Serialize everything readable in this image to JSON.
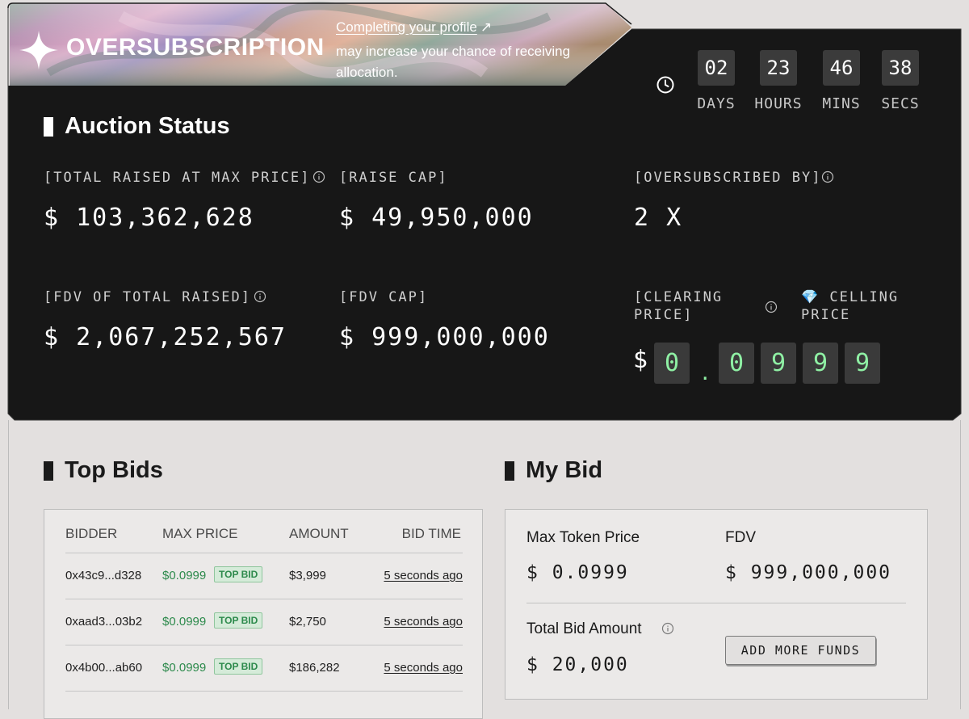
{
  "banner": {
    "title": "OVERSUBSCRIPTION",
    "link_text": "Completing your profile",
    "link_arrow": "↗",
    "subtitle": "may increase your chance of receiving allocation."
  },
  "countdown": [
    {
      "value": "02",
      "label": "DAYS"
    },
    {
      "value": "23",
      "label": "HOURS"
    },
    {
      "value": "46",
      "label": "MINS"
    },
    {
      "value": "38",
      "label": "SECS"
    }
  ],
  "auction": {
    "title": "Auction Status",
    "total_raised_label": "[TOTAL RAISED AT MAX PRICE]",
    "total_raised_value": "$ 103,362,628",
    "raise_cap_label": "[RAISE CAP]",
    "raise_cap_value": "$ 49,950,000",
    "oversubscribed_label": "[OVERSUBSCRIBED BY]",
    "oversubscribed_value": "2 X",
    "fdv_total_label": "[FDV OF TOTAL RAISED]",
    "fdv_total_value": "$ 2,067,252,567",
    "fdv_cap_label": "[FDV CAP]",
    "fdv_cap_value": "$ 999,000,000",
    "clearing_label_line1": "[CLEARING",
    "clearing_label_line2": "PRICE]",
    "ceiling_icon": "💎",
    "ceiling_label_line1": "CELLING",
    "ceiling_label_line2": "PRICE",
    "price_currency": "$",
    "price_digits": [
      "0",
      ".",
      "0",
      "9",
      "9",
      "9"
    ]
  },
  "top_bids": {
    "title": "Top Bids",
    "columns": [
      "BIDDER",
      "MAX PRICE",
      "AMOUNT",
      "BID TIME"
    ],
    "rows": [
      {
        "bidder": "0x43c9...d328",
        "max_price": "$0.0999",
        "badge": "TOP BID",
        "amount": "$3,999",
        "time": "5 seconds ago"
      },
      {
        "bidder": "0xaad3...03b2",
        "max_price": "$0.0999",
        "badge": "TOP BID",
        "amount": "$2,750",
        "time": "5 seconds ago"
      },
      {
        "bidder": "0x4b00...ab60",
        "max_price": "$0.0999",
        "badge": "TOP BID",
        "amount": "$186,282",
        "time": "5 seconds ago"
      }
    ]
  },
  "my_bid": {
    "title": "My Bid",
    "max_token_price_label": "Max Token Price",
    "max_token_price_value": "$ 0.0999",
    "fdv_label": "FDV",
    "fdv_value": "$ 999,000,000",
    "total_bid_label": "Total Bid Amount",
    "total_bid_value": "$ 20,000",
    "add_funds_label": "ADD MORE FUNDS"
  },
  "colors": {
    "panel": "#171717",
    "accent_green": "#8ff0a4",
    "price_green": "#2d8a4c",
    "background": "#e3e0df"
  }
}
